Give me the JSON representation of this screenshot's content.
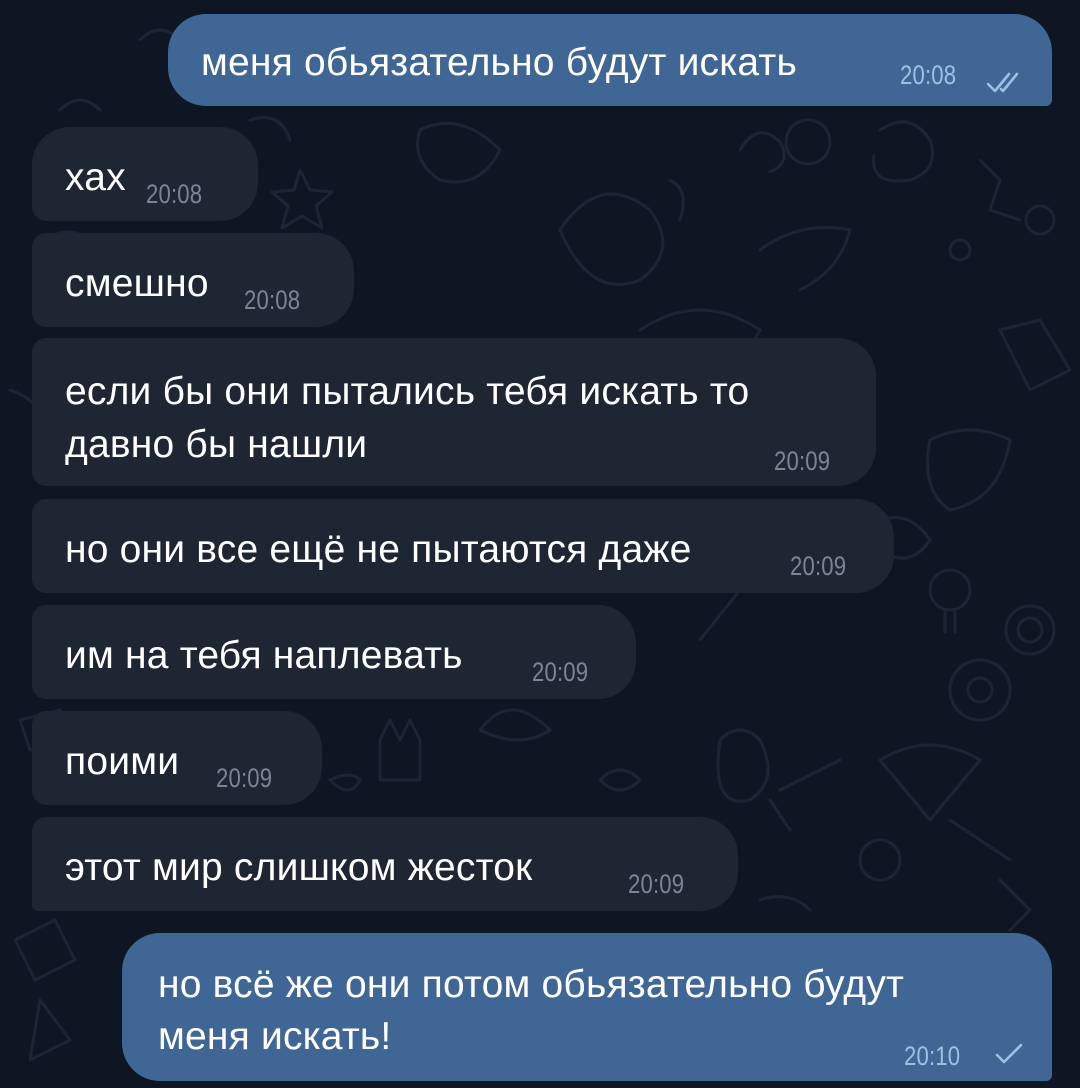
{
  "messages": [
    {
      "direction": "out",
      "lines": [
        "меня обьязательно будут искать"
      ],
      "time": "20:08",
      "status": "read",
      "status_icon": "double-check-icon"
    },
    {
      "direction": "in",
      "lines": [
        "хах"
      ],
      "time": "20:08"
    },
    {
      "direction": "in",
      "lines": [
        "смешно"
      ],
      "time": "20:08"
    },
    {
      "direction": "in",
      "lines": [
        "если бы они пытались тебя искать то",
        "давно бы нашли"
      ],
      "time": "20:09"
    },
    {
      "direction": "in",
      "lines": [
        "но они все ещё не пытаются даже"
      ],
      "time": "20:09"
    },
    {
      "direction": "in",
      "lines": [
        "им на тебя наплевать"
      ],
      "time": "20:09"
    },
    {
      "direction": "in",
      "lines": [
        "поими"
      ],
      "time": "20:09"
    },
    {
      "direction": "in",
      "lines": [
        "этот мир слишком жесток"
      ],
      "time": "20:09"
    },
    {
      "direction": "out",
      "lines": [
        "но всё же они потом  обьязательно будут",
        "меня искать!"
      ],
      "time": "20:10",
      "status": "sent",
      "status_icon": "single-check-icon"
    }
  ],
  "colors": {
    "background": "#0f1623",
    "incoming_bubble": "#1e2533",
    "outgoing_bubble": "#3f6694",
    "incoming_time": "#7c8594",
    "outgoing_time": "#9fc0e4",
    "wallpaper_doodle": "#1d2838"
  }
}
